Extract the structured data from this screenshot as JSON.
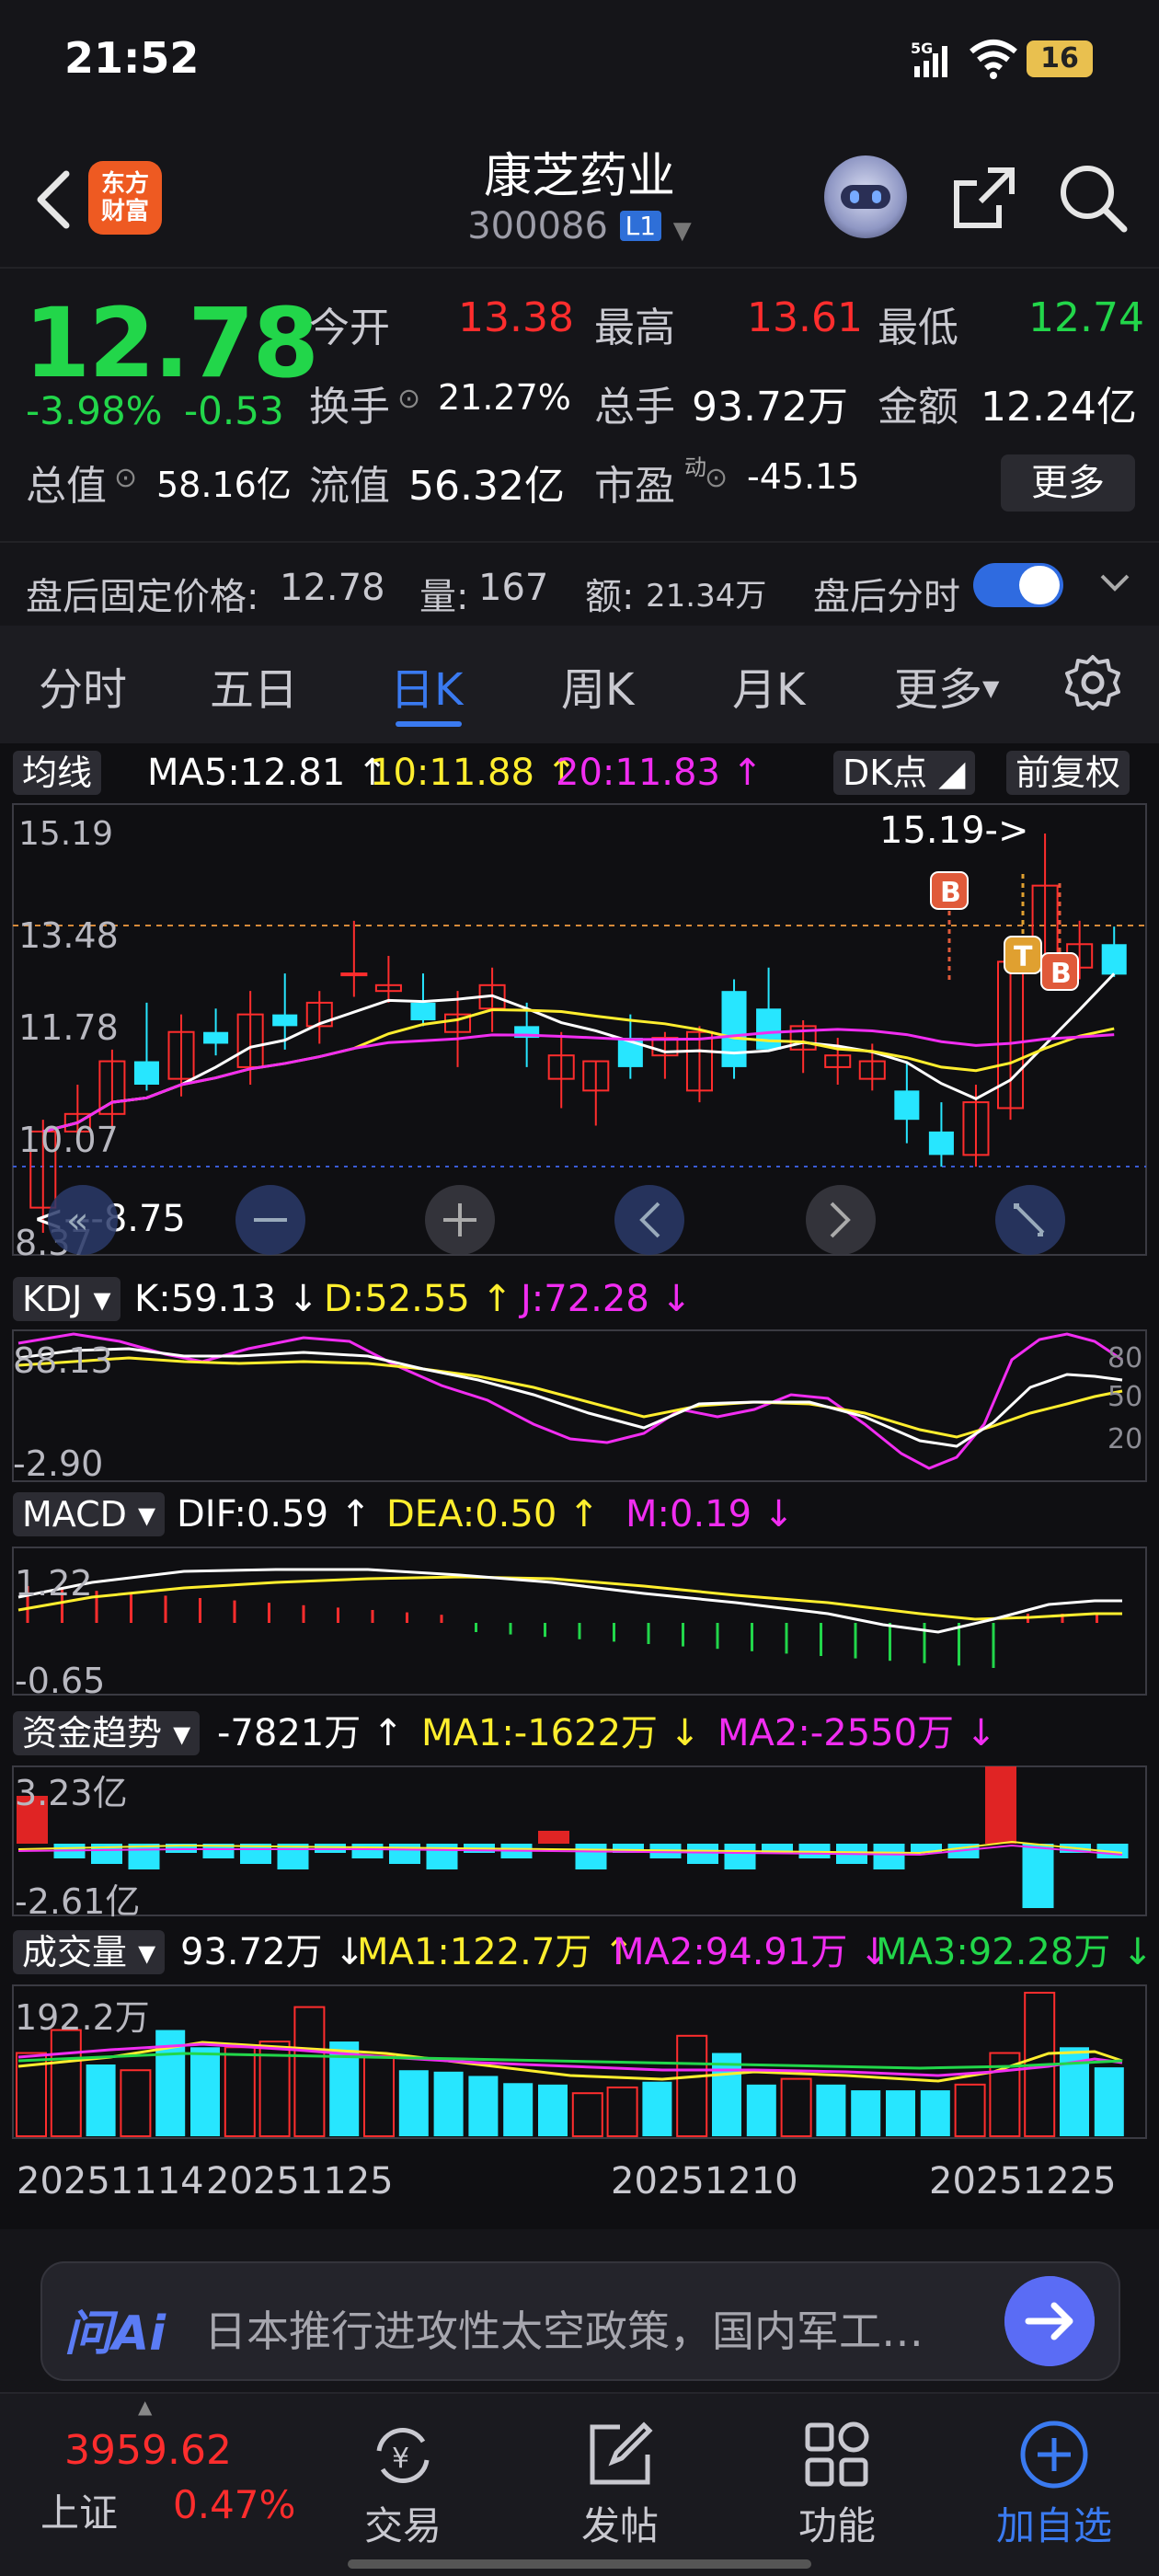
{
  "status": {
    "time": "21:52",
    "network": "5G",
    "battery": "16"
  },
  "header": {
    "logo_line1": "东方",
    "logo_line2": "财富",
    "name": "康芝药业",
    "code": "300086",
    "level": "L1"
  },
  "quote": {
    "price": "12.78",
    "change_pct": "-3.98%",
    "change_val": "-0.53",
    "open_label": "今开",
    "open": "13.38",
    "high_label": "最高",
    "high": "13.61",
    "low_label": "最低",
    "low": "12.74",
    "turnover_label": "换手",
    "turnover": "21.27%",
    "volume_label": "总手",
    "volume": "93.72万",
    "amount_label": "金额",
    "amount": "12.24亿",
    "mcap_label": "总值",
    "mcap": "58.16亿",
    "float_label": "流值",
    "float": "56.32亿",
    "pe_label": "市盈",
    "pe_sup": "动",
    "pe": "-45.15",
    "more": "更多"
  },
  "afterhours": {
    "price_label": "盘后固定价格:",
    "price": "12.78",
    "vol_label": "量:",
    "vol": "167",
    "amt_label": "额:",
    "amt": "21.34万",
    "timeshare_label": "盘后分时"
  },
  "tabs": [
    "分时",
    "五日",
    "日K",
    "周K",
    "月K",
    "更多"
  ],
  "active_tab": "日K",
  "kline": {
    "ma_pill": "均线",
    "ma5": "MA5:12.81",
    "ma10": "10:11.88",
    "ma20": "20:11.83",
    "dk_pill": "DK点",
    "adj_pill": "前复权",
    "y_labels": [
      "15.19",
      "13.48",
      "11.78",
      "10.07",
      "8.37"
    ],
    "max_annot": "15.19->",
    "min_annot": "<---8.75",
    "signal_b": "B",
    "signal_t": "T"
  },
  "kdj": {
    "pill": "KDJ",
    "k": "K:59.13",
    "d": "D:52.55",
    "j": "J:72.28",
    "y_top": "88.13",
    "y_bottom": "-2.90",
    "levels": [
      "80",
      "50",
      "20"
    ]
  },
  "macd": {
    "pill": "MACD",
    "dif": "DIF:0.59",
    "dea": "DEA:0.50",
    "m": "M:0.19",
    "y_top": "1.22",
    "y_bottom": "-0.65"
  },
  "fund": {
    "pill": "资金趋势",
    "value": "-7821万",
    "ma1": "MA1:-1622万",
    "ma2": "MA2:-2550万",
    "y_top": "3.23亿",
    "y_bottom": "-2.61亿"
  },
  "vol": {
    "pill": "成交量",
    "value": "93.72万",
    "ma1": "MA1:122.7万",
    "ma2": "MA2:94.91万",
    "ma3": "MA3:92.28万",
    "y_top": "192.2万"
  },
  "dates": [
    "20251114",
    "20251125",
    "20251210",
    "20251225"
  ],
  "ai": {
    "logo": "问Ai",
    "text": "日本推行进攻性太空政策，国内军工…"
  },
  "nav": {
    "index_value": "3959.62",
    "index_name": "上证",
    "index_pct": "0.47%",
    "items": [
      "交易",
      "发帖",
      "功能",
      "加自选"
    ]
  },
  "chart_data": {
    "type": "candlestick",
    "title": "",
    "ylim": [
      8.37,
      15.19
    ],
    "candles": [
      {
        "o": 8.8,
        "h": 10.3,
        "l": 8.37,
        "c": 10.1
      },
      {
        "o": 10.1,
        "h": 10.9,
        "l": 9.9,
        "c": 10.4
      },
      {
        "o": 10.4,
        "h": 11.5,
        "l": 10.1,
        "c": 11.3
      },
      {
        "o": 11.3,
        "h": 12.3,
        "l": 10.8,
        "c": 10.9
      },
      {
        "o": 11.0,
        "h": 12.1,
        "l": 10.7,
        "c": 11.8
      },
      {
        "o": 11.8,
        "h": 12.2,
        "l": 11.4,
        "c": 11.6
      },
      {
        "o": 11.2,
        "h": 12.5,
        "l": 10.9,
        "c": 12.1
      },
      {
        "o": 12.1,
        "h": 12.8,
        "l": 11.5,
        "c": 11.9
      },
      {
        "o": 11.9,
        "h": 12.5,
        "l": 11.6,
        "c": 12.3
      },
      {
        "o": 12.8,
        "h": 13.7,
        "l": 12.4,
        "c": 12.8
      },
      {
        "o": 12.5,
        "h": 13.1,
        "l": 12.3,
        "c": 12.6
      },
      {
        "o": 12.3,
        "h": 12.8,
        "l": 11.9,
        "c": 12.0
      },
      {
        "o": 11.8,
        "h": 12.5,
        "l": 11.2,
        "c": 12.1
      },
      {
        "o": 12.2,
        "h": 12.9,
        "l": 11.8,
        "c": 12.6
      },
      {
        "o": 11.9,
        "h": 12.3,
        "l": 11.2,
        "c": 11.7
      },
      {
        "o": 11.0,
        "h": 11.8,
        "l": 10.5,
        "c": 11.4
      },
      {
        "o": 10.8,
        "h": 11.3,
        "l": 10.2,
        "c": 11.3
      },
      {
        "o": 11.7,
        "h": 12.1,
        "l": 11.0,
        "c": 11.2
      },
      {
        "o": 11.4,
        "h": 11.8,
        "l": 11.0,
        "c": 11.7
      },
      {
        "o": 10.8,
        "h": 11.9,
        "l": 10.6,
        "c": 11.8
      },
      {
        "o": 12.5,
        "h": 12.7,
        "l": 11.0,
        "c": 11.2
      },
      {
        "o": 12.2,
        "h": 12.9,
        "l": 11.6,
        "c": 11.5
      },
      {
        "o": 11.5,
        "h": 12.0,
        "l": 11.1,
        "c": 11.9
      },
      {
        "o": 11.2,
        "h": 11.7,
        "l": 10.9,
        "c": 11.4
      },
      {
        "o": 11.0,
        "h": 11.6,
        "l": 10.8,
        "c": 11.3
      },
      {
        "o": 10.8,
        "h": 11.3,
        "l": 9.9,
        "c": 10.3
      },
      {
        "o": 10.1,
        "h": 10.6,
        "l": 9.5,
        "c": 9.7
      },
      {
        "o": 9.7,
        "h": 10.9,
        "l": 9.5,
        "c": 10.6
      },
      {
        "o": 10.5,
        "h": 13.0,
        "l": 10.3,
        "c": 13.0
      },
      {
        "o": 13.0,
        "h": 15.19,
        "l": 12.8,
        "c": 14.3
      },
      {
        "o": 12.9,
        "h": 13.7,
        "l": 12.7,
        "c": 13.3
      },
      {
        "o": 13.3,
        "h": 13.6,
        "l": 12.74,
        "c": 12.78
      }
    ]
  }
}
